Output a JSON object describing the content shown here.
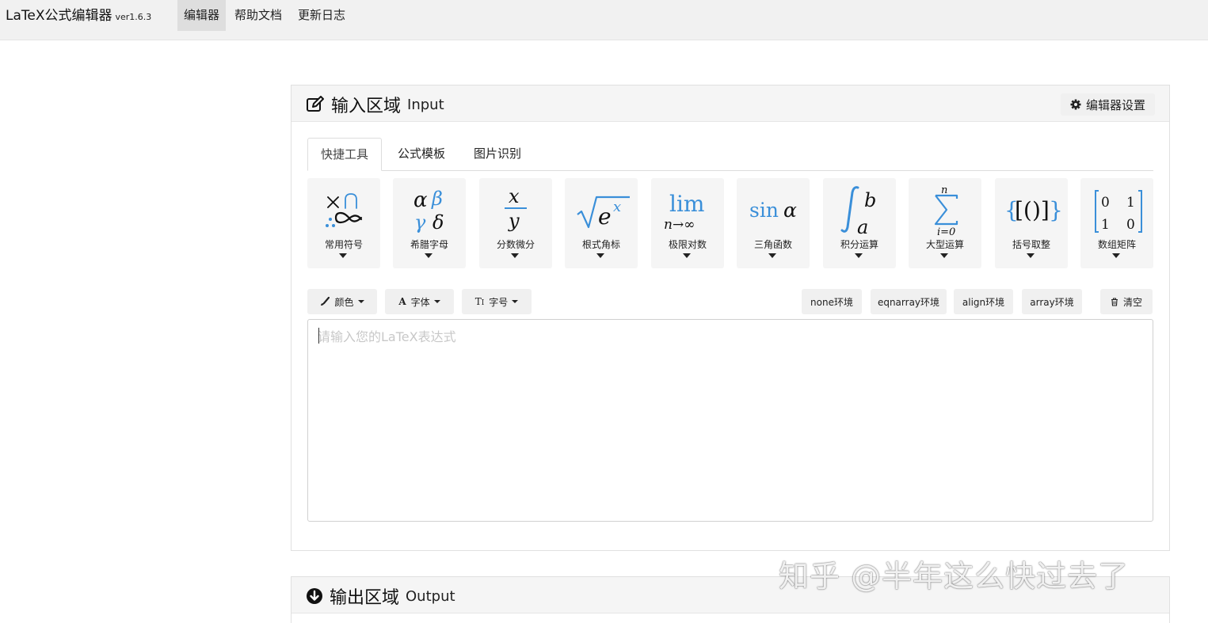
{
  "navbar": {
    "brand": "LaTeX公式编辑器",
    "version": "ver1.6.3",
    "items": [
      {
        "label": "编辑器",
        "active": true
      },
      {
        "label": "帮助文档",
        "active": false
      },
      {
        "label": "更新日志",
        "active": false
      }
    ]
  },
  "input_panel": {
    "title": "输入区域",
    "title_en": "Input",
    "settings_label": "编辑器设置",
    "tabs": [
      "快捷工具",
      "公式模板",
      "图片识别"
    ],
    "tools": [
      {
        "label": "常用符号",
        "icon": "common-symbols"
      },
      {
        "label": "希腊字母",
        "icon": "greek-letters"
      },
      {
        "label": "分数微分",
        "icon": "fraction"
      },
      {
        "label": "根式角标",
        "icon": "radical"
      },
      {
        "label": "极限对数",
        "icon": "limit"
      },
      {
        "label": "三角函数",
        "icon": "trig"
      },
      {
        "label": "积分运算",
        "icon": "integral"
      },
      {
        "label": "大型运算",
        "icon": "big-operator"
      },
      {
        "label": "括号取整",
        "icon": "brackets"
      },
      {
        "label": "数组矩阵",
        "icon": "matrix"
      }
    ],
    "format": {
      "color_label": "颜色",
      "font_label": "字体",
      "size_label": "字号"
    },
    "env": {
      "none": "none环境",
      "eqnarray": "eqnarray环境",
      "align": "align环境",
      "array": "array环境"
    },
    "clear_label": "清空",
    "editor_placeholder": "请输入您的LaTeX表达式"
  },
  "output_panel": {
    "title": "输出区域",
    "title_en": "Output"
  },
  "watermark": "知乎 @半年这么快过去了",
  "colors": {
    "accent_blue": "#3a8fd9",
    "navbar_bg": "#f1f1f1",
    "panel_head_bg": "#f5f5f5"
  }
}
